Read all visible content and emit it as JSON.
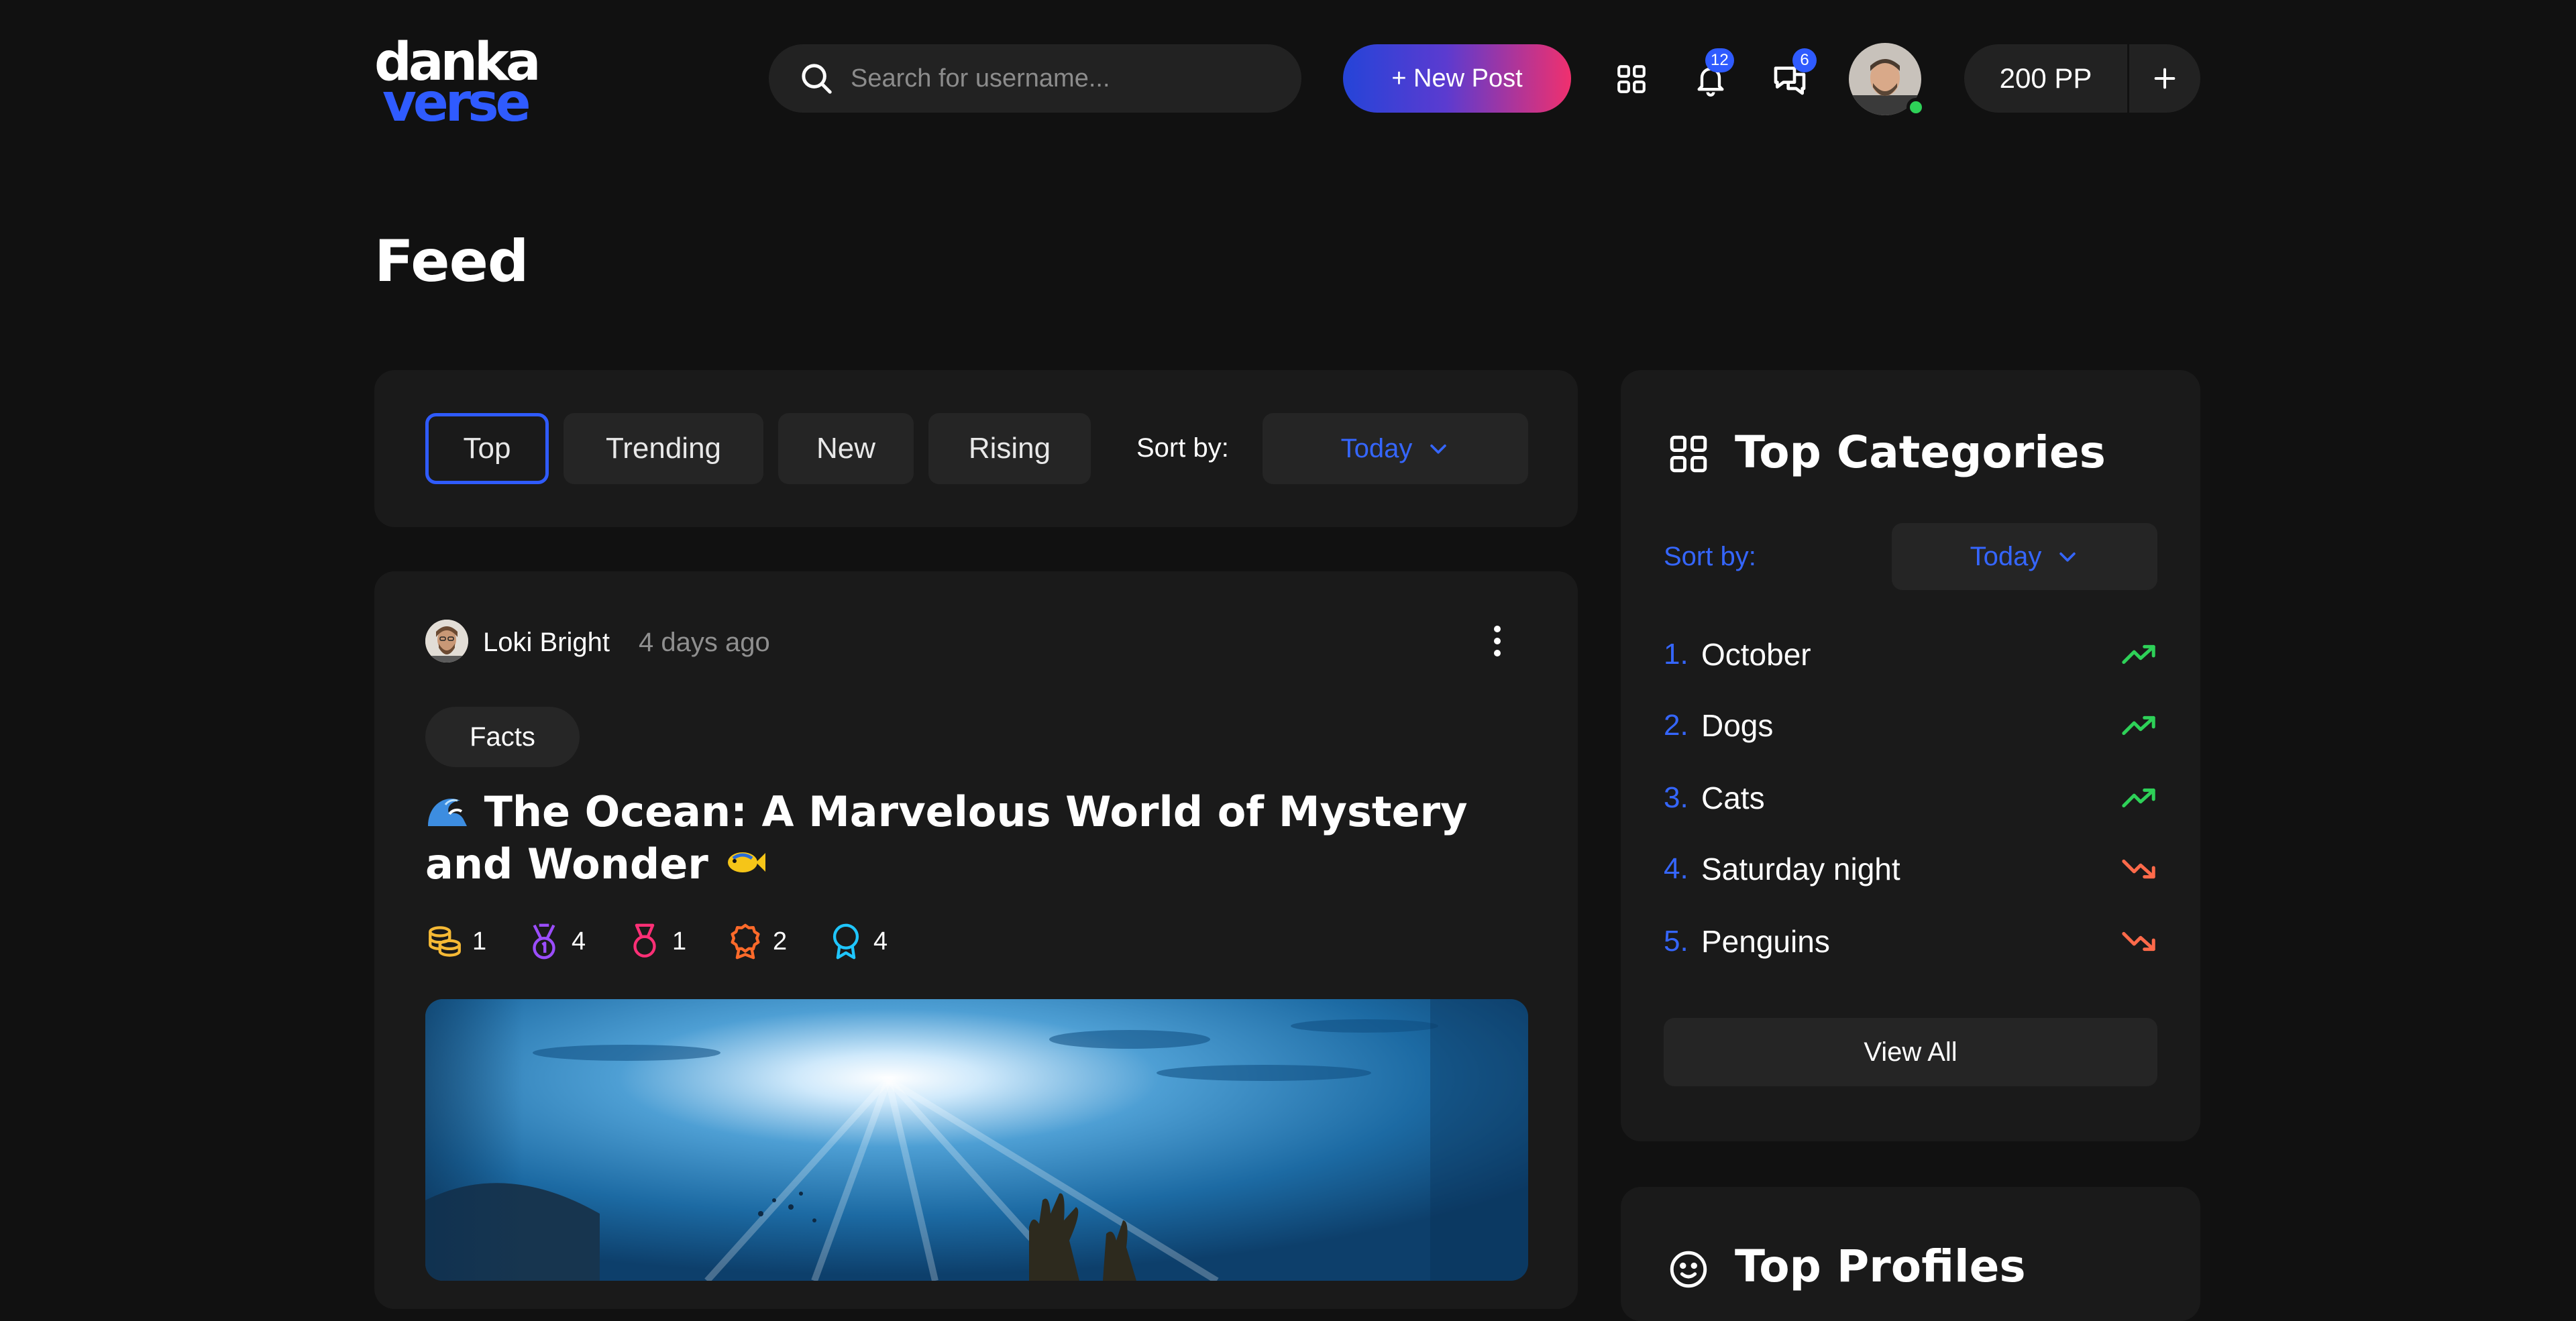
{
  "header": {
    "logo_top": "danka",
    "logo_bottom": "verse",
    "search_placeholder": "Search for username...",
    "new_post_label": "+ New Post",
    "notifications_count": "12",
    "messages_count": "6",
    "points_label": "200 PP",
    "icons": [
      "search-icon",
      "grid-icon",
      "bell-icon",
      "chat-icon",
      "plus-icon"
    ]
  },
  "page": {
    "title": "Feed"
  },
  "filter": {
    "tabs": [
      {
        "label": "Top",
        "active": true
      },
      {
        "label": "Trending",
        "active": false
      },
      {
        "label": "New",
        "active": false
      },
      {
        "label": "Rising",
        "active": false
      }
    ],
    "sort_label": "Sort by:",
    "sort_value": "Today"
  },
  "post": {
    "author": "Loki Bright",
    "time": "4 days ago",
    "tag": "Facts",
    "title": "The Ocean: A Marvelous World of Mystery and Wonder",
    "awards": [
      {
        "icon": "coins-icon",
        "count": "1",
        "color": "#f5b935"
      },
      {
        "icon": "medal-purple-icon",
        "count": "4",
        "color": "#9b4dff"
      },
      {
        "icon": "medal-pink-icon",
        "count": "1",
        "color": "#ff2f76"
      },
      {
        "icon": "badge-orange-icon",
        "count": "2",
        "color": "#ff6a2a"
      },
      {
        "icon": "ribbon-cyan-icon",
        "count": "4",
        "color": "#1fc6ff"
      }
    ]
  },
  "categories": {
    "title": "Top Categories",
    "sort_label": "Sort by:",
    "sort_value": "Today",
    "items": [
      {
        "rank": "1.",
        "name": "October",
        "trend": "up"
      },
      {
        "rank": "2.",
        "name": "Dogs",
        "trend": "up"
      },
      {
        "rank": "3.",
        "name": "Cats",
        "trend": "up"
      },
      {
        "rank": "4.",
        "name": "Saturday night",
        "trend": "down"
      },
      {
        "rank": "5.",
        "name": "Penguins",
        "trend": "down"
      }
    ],
    "view_all_label": "View All"
  },
  "profiles": {
    "title": "Top Profiles"
  },
  "colors": {
    "accent": "#2f5bff",
    "trend_up": "#2ed158",
    "trend_down": "#ff6a4a",
    "background": "#111111",
    "card": "#1a1a1a"
  }
}
